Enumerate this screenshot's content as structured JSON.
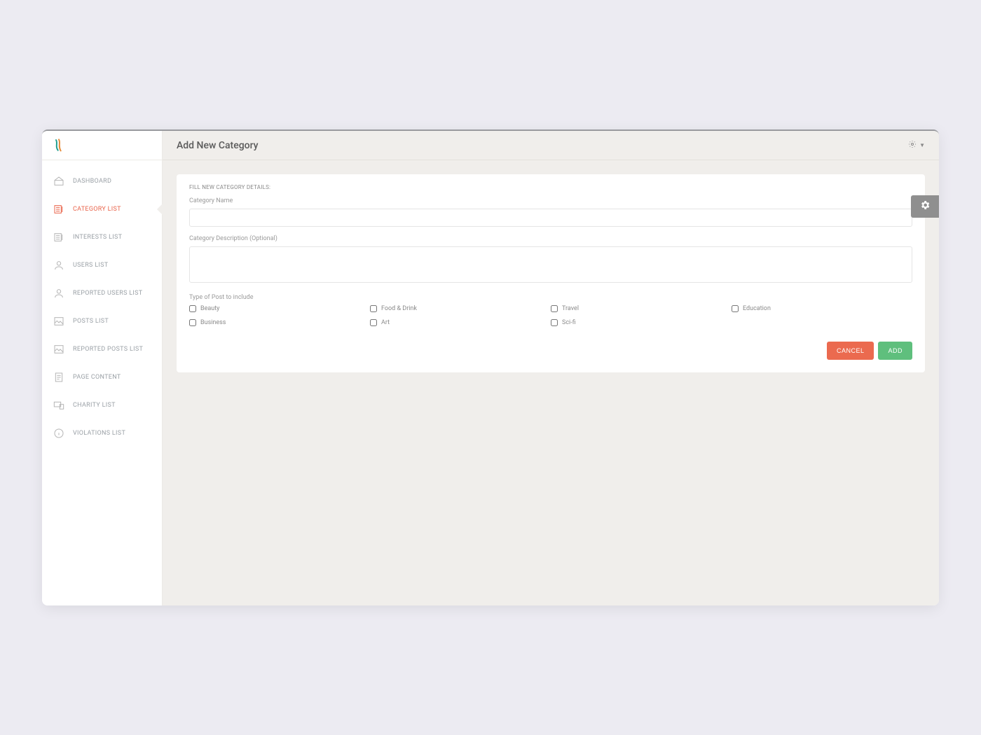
{
  "page": {
    "title": "Add New Category"
  },
  "sidebar": {
    "items": [
      {
        "label": "DASHBOARD",
        "icon": "dashboard-icon",
        "active": false
      },
      {
        "label": "CATEGORY LIST",
        "icon": "list-icon",
        "active": true
      },
      {
        "label": "INTERESTS LIST",
        "icon": "list-icon",
        "active": false
      },
      {
        "label": "USERS LIST",
        "icon": "user-icon",
        "active": false
      },
      {
        "label": "REPORTED USERS LIST",
        "icon": "user-icon",
        "active": false
      },
      {
        "label": "POSTS LIST",
        "icon": "image-icon",
        "active": false
      },
      {
        "label": "REPORTED POSTS LIST",
        "icon": "image-icon",
        "active": false
      },
      {
        "label": "PAGE CONTENT",
        "icon": "document-icon",
        "active": false
      },
      {
        "label": "CHARITY LIST",
        "icon": "devices-icon",
        "active": false
      },
      {
        "label": "VIOLATIONS LIST",
        "icon": "info-icon",
        "active": false
      }
    ]
  },
  "form": {
    "section_title": "FILL NEW CATEGORY DETAILS:",
    "name_label": "Category Name",
    "name_value": "",
    "description_label": "Category Description (Optional)",
    "description_value": "",
    "post_type_label": "Type of Post to include",
    "checkboxes": [
      {
        "label": "Beauty",
        "checked": false
      },
      {
        "label": "Food & Drink",
        "checked": false
      },
      {
        "label": "Travel",
        "checked": false
      },
      {
        "label": "Education",
        "checked": false
      },
      {
        "label": "Business",
        "checked": false
      },
      {
        "label": "Art",
        "checked": false
      },
      {
        "label": "Sci-fi",
        "checked": false
      }
    ]
  },
  "buttons": {
    "cancel": "CANCEL",
    "add": "ADD"
  },
  "colors": {
    "accent": "#e9634a",
    "success": "#5fbf7d",
    "muted": "#9aa0a6"
  }
}
